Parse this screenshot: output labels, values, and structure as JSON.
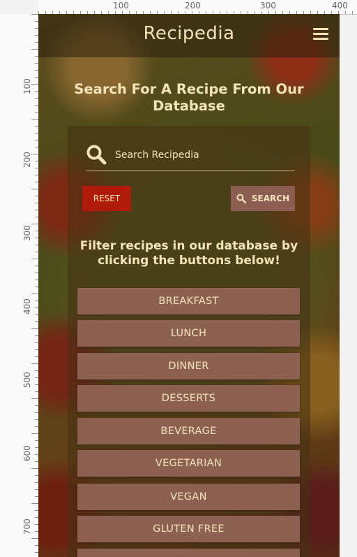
{
  "ruler": {
    "top_labels": [
      "100",
      "200",
      "300",
      "400"
    ],
    "left_labels": [
      "100",
      "200",
      "300",
      "400",
      "500",
      "600",
      "700"
    ]
  },
  "navbar": {
    "brand": "Recipedia",
    "menu_icon": "hamburger-icon"
  },
  "main": {
    "headline": "Search For A Recipe From Our Database",
    "search": {
      "placeholder": "Search Recipedia",
      "value": "",
      "icon": "search-icon"
    },
    "buttons": {
      "reset_label": "RESET",
      "search_label": "SEARCH"
    },
    "filter_heading": "Filter recipes in our database by clicking the buttons below!",
    "categories": [
      "BREAKFAST",
      "LUNCH",
      "DINNER",
      "DESSERTS",
      "BEVERAGE",
      "VEGETARIAN",
      "VEGAN",
      "GLUTEN FREE"
    ]
  },
  "colors": {
    "text": "#f2e3b8",
    "reset": "#b01a08",
    "button": "#8d6152"
  }
}
